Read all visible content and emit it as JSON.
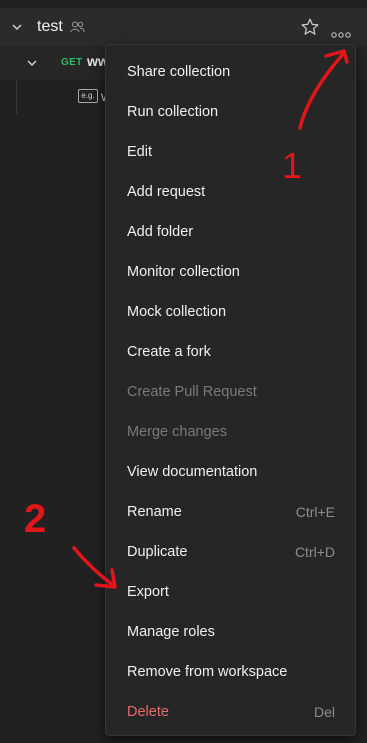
{
  "sidebar": {
    "collection": {
      "name": "test",
      "expanded": true
    },
    "request": {
      "method": "GET",
      "name": "ww"
    },
    "example": {
      "badge": "e.g.",
      "name": "w"
    }
  },
  "context_menu": {
    "items": [
      {
        "label": "Share collection",
        "shortcut": "",
        "state": "enabled"
      },
      {
        "label": "Run collection",
        "shortcut": "",
        "state": "enabled"
      },
      {
        "label": "Edit",
        "shortcut": "",
        "state": "enabled"
      },
      {
        "label": "Add request",
        "shortcut": "",
        "state": "enabled"
      },
      {
        "label": "Add folder",
        "shortcut": "",
        "state": "enabled"
      },
      {
        "label": "Monitor collection",
        "shortcut": "",
        "state": "enabled"
      },
      {
        "label": "Mock collection",
        "shortcut": "",
        "state": "enabled"
      },
      {
        "label": "Create a fork",
        "shortcut": "",
        "state": "enabled"
      },
      {
        "label": "Create Pull Request",
        "shortcut": "",
        "state": "disabled"
      },
      {
        "label": "Merge changes",
        "shortcut": "",
        "state": "disabled"
      },
      {
        "label": "View documentation",
        "shortcut": "",
        "state": "enabled"
      },
      {
        "label": "Rename",
        "shortcut": "Ctrl+E",
        "state": "enabled"
      },
      {
        "label": "Duplicate",
        "shortcut": "Ctrl+D",
        "state": "enabled"
      },
      {
        "label": "Export",
        "shortcut": "",
        "state": "enabled"
      },
      {
        "label": "Manage roles",
        "shortcut": "",
        "state": "enabled"
      },
      {
        "label": "Remove from workspace",
        "shortcut": "",
        "state": "enabled"
      },
      {
        "label": "Delete",
        "shortcut": "Del",
        "state": "danger"
      }
    ]
  },
  "annotations": {
    "step1": "1",
    "step2": "2",
    "color": "#e0161b"
  },
  "icons": {
    "collection_chevron": "chevron-down-icon",
    "people": "people-icon",
    "star": "star-icon",
    "more": "more-horizontal-icon",
    "example": "example-badge-icon"
  }
}
